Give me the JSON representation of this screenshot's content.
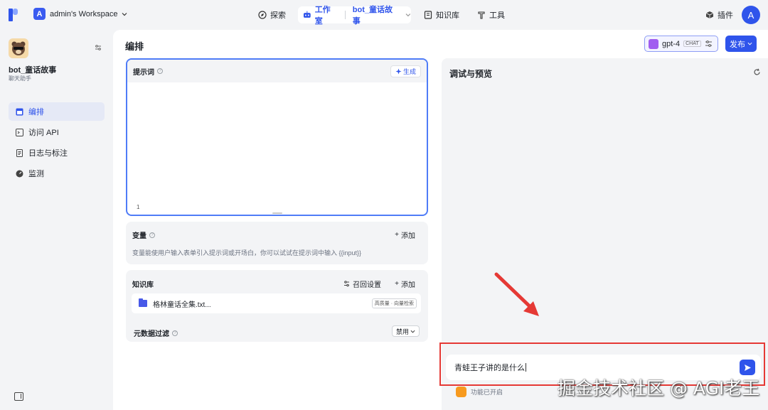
{
  "header": {
    "workspace_initial": "A",
    "workspace_name": "admin's Workspace",
    "nav_explore": "探索",
    "nav_studio": "工作室",
    "bot_tab": "bot_童话故事",
    "nav_knowledge": "知识库",
    "nav_tools": "工具",
    "nav_plugins": "插件",
    "user_initial": "A"
  },
  "sidebar": {
    "bot_name": "bot_童话故事",
    "bot_subtitle": "聊天助手",
    "items": [
      {
        "label": "编排"
      },
      {
        "label": "访问 API"
      },
      {
        "label": "日志与标注"
      },
      {
        "label": "监测"
      }
    ]
  },
  "main": {
    "title": "编排",
    "model_name": "gpt-4",
    "model_badge": "CHAT",
    "publish_label": "发布"
  },
  "prompt": {
    "title": "提示词",
    "generate_label": "生成",
    "line_number": "1"
  },
  "variables": {
    "title": "变量",
    "add_label": "添加",
    "description": "变量能使用户输入表单引入提示词或开场白，你可以试试在提示词中输入 {{input}}"
  },
  "knowledge": {
    "title": "知识库",
    "recall_label": "召回设置",
    "add_label": "添加",
    "item_name": "格林童话全集.txt...",
    "item_tag": "高质量 · 向量检索",
    "metadata_filter_label": "元数据过滤",
    "metadata_filter_value": "禁用"
  },
  "debug": {
    "title": "调试与预览",
    "input_value": "青蛙王子讲的是什么",
    "feature_text": "功能已开启"
  },
  "watermark": "掘金技术社区 @ AGI老王",
  "colors": {
    "accent": "#2f54eb",
    "annotation": "#e53935"
  }
}
